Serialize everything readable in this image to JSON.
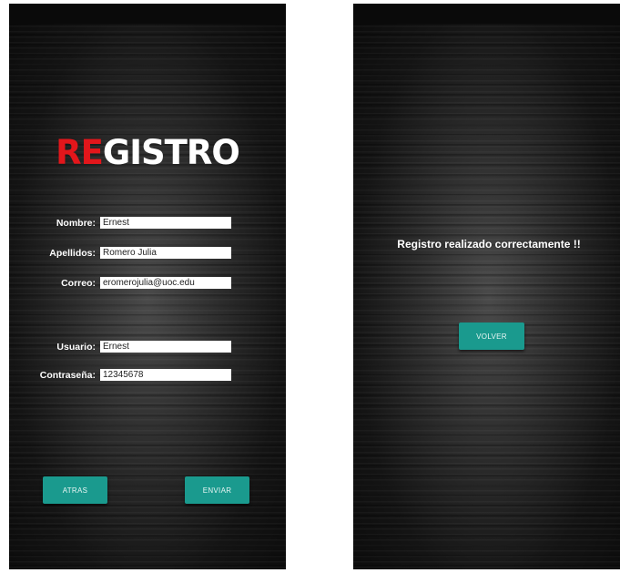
{
  "registration_screen": {
    "logo": {
      "part1": "RE",
      "part2": "GISTRO"
    },
    "fields": [
      {
        "label": "Nombre:",
        "value": "Ernest"
      },
      {
        "label": "Apellidos:",
        "value": "Romero Julia"
      },
      {
        "label": "Correo:",
        "value": "eromerojulia@uoc.edu"
      },
      {
        "label": "Usuario:",
        "value": "Ernest"
      },
      {
        "label": "Contraseña:",
        "value": "12345678"
      }
    ],
    "buttons": {
      "back": "ATRAS",
      "send": "ENVIAR"
    }
  },
  "confirmation_screen": {
    "message": "Registro realizado correctamente !!",
    "button": "VOLVER"
  },
  "colors": {
    "logo_accent": "#e3161b",
    "button": "#1a9a8e",
    "background": "#1e1e1e"
  }
}
